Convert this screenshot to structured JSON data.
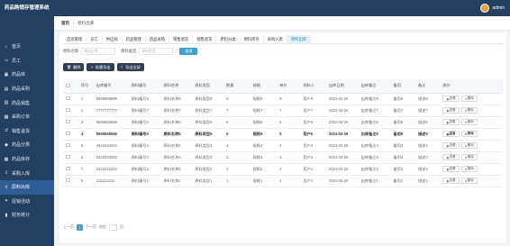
{
  "app": {
    "title": "药品购销存管理系统"
  },
  "user": {
    "name": "admin"
  },
  "sidebar": {
    "items": [
      {
        "label": "首页",
        "icon": "home-icon",
        "active": false
      },
      {
        "label": "员工",
        "icon": "user-icon",
        "active": false
      },
      {
        "label": "药品库",
        "icon": "box-icon",
        "active": false
      },
      {
        "label": "药品采购",
        "icon": "cart-icon",
        "active": false
      },
      {
        "label": "药品销售",
        "icon": "sale-icon",
        "active": false
      },
      {
        "label": "采购订单",
        "icon": "order-icon",
        "active": false
      },
      {
        "label": "销售退货",
        "icon": "return-icon",
        "active": false
      },
      {
        "label": "药品分类",
        "icon": "tag-icon",
        "active": false
      },
      {
        "label": "药品库存",
        "icon": "stock-icon",
        "active": false
      },
      {
        "label": "采购入库",
        "icon": "inbound-icon",
        "active": false
      },
      {
        "label": "原料出库",
        "icon": "outbound-icon",
        "active": true
      },
      {
        "label": "促销活动",
        "icon": "gift-icon",
        "active": false
      },
      {
        "label": "财务统计",
        "icon": "chart-icon",
        "active": false
      }
    ]
  },
  "breadcrumb": {
    "home": "首页",
    "current": "原料出库"
  },
  "menubar": {
    "items": [
      {
        "label": "首页管理",
        "active": false
      },
      {
        "label": "员工",
        "active": false
      },
      {
        "label": "供应商",
        "active": false
      },
      {
        "label": "药品管理",
        "active": false
      },
      {
        "label": "药品采购",
        "active": false
      },
      {
        "label": "销售退货",
        "active": false
      },
      {
        "label": "销售退货",
        "active": false
      },
      {
        "label": "原料分类",
        "active": false
      },
      {
        "label": "原料库存",
        "active": false
      },
      {
        "label": "采购入库",
        "active": false
      },
      {
        "label": "原料出库",
        "active": true
      }
    ]
  },
  "search": {
    "name_label": "原料名称",
    "name_placeholder": "原料名称",
    "type_label": "原料类型",
    "type_placeholder": "原料类型",
    "button": "查询"
  },
  "actions": {
    "delete": "删除",
    "export_selected": "批量导出",
    "export_all": "导出全部"
  },
  "table": {
    "headers": [
      "",
      "序号",
      "出库编号",
      "原料编号",
      "原料名称",
      "原料类型",
      "数量",
      "规格",
      "单价",
      "领料人",
      "出库日期",
      "出库备注",
      "备用",
      "备注",
      "操作"
    ],
    "rows": [
      {
        "no": "1",
        "out_no": "9999999999",
        "code": "原料编号9",
        "name": "原料名称9",
        "type": "原料类型9",
        "qty": "9",
        "spec": "规格9",
        "price": "9",
        "taker": "用户9",
        "date": "2024-03-26",
        "remark": "出库备注9",
        "extra": "备用9",
        "note": "描述9",
        "highlight": false
      },
      {
        "no": "2",
        "out_no": "7777777777",
        "code": "原料编号7",
        "name": "原料名称7",
        "type": "原料类型7",
        "qty": "7",
        "spec": "规格7",
        "price": "7",
        "taker": "用户7",
        "date": "2024-03-26",
        "remark": "出库备注7",
        "extra": "备用7",
        "note": "描述7",
        "highlight": false
      },
      {
        "no": "3",
        "out_no": "6666666666",
        "code": "原料编号6",
        "name": "原料名称6",
        "type": "原料类型6",
        "qty": "6",
        "spec": "规格6",
        "price": "6",
        "taker": "用户6",
        "date": "2024-03-26",
        "remark": "出库备注6",
        "extra": "备用6",
        "note": "描述6",
        "highlight": false
      },
      {
        "no": "4",
        "out_no": "5555555555",
        "code": "原料编号5",
        "name": "原料名称5",
        "type": "原料类型5",
        "qty": "5",
        "spec": "规格5",
        "price": "5",
        "taker": "用户5",
        "date": "2024-03-26",
        "remark": "出库备注5",
        "extra": "备用5",
        "note": "描述5",
        "highlight": true
      },
      {
        "no": "5",
        "out_no": "4444444444",
        "code": "原料编号4",
        "name": "原料名称4",
        "type": "原料类型4",
        "qty": "4",
        "spec": "规格4",
        "price": "4",
        "taker": "用户4",
        "date": "2024-03-26",
        "remark": "出库备注4",
        "extra": "备用4",
        "note": "描述4",
        "highlight": false
      },
      {
        "no": "6",
        "out_no": "3333333333",
        "code": "原料编号3",
        "name": "原料名称3",
        "type": "原料类型3",
        "qty": "3",
        "spec": "规格3",
        "price": "3",
        "taker": "用户3",
        "date": "2024-03-26",
        "remark": "出库备注3",
        "extra": "备用3",
        "note": "描述3",
        "highlight": false
      },
      {
        "no": "7",
        "out_no": "2222222222",
        "code": "原料编号2",
        "name": "原料名称2",
        "type": "原料类型2",
        "qty": "2",
        "spec": "规格2",
        "price": "2",
        "taker": "用户2",
        "date": "2024-03-26",
        "remark": "出库备注2",
        "extra": "备用2",
        "note": "描述2",
        "highlight": false
      },
      {
        "no": "8",
        "out_no": "1111111111",
        "code": "原料编号1",
        "name": "原料名称1",
        "type": "原料类型1",
        "qty": "1",
        "spec": "规格1",
        "price": "1",
        "taker": "用户1",
        "date": "2024-03-26",
        "remark": "出库备注1",
        "extra": "备用1",
        "note": "描述1",
        "highlight": false
      }
    ],
    "view_label": "查看",
    "delete_label": "删除"
  },
  "pagination": {
    "prev": "上一页",
    "current": "1",
    "next": "下一页",
    "goto_label": "前往",
    "page_unit": "页"
  },
  "colors": {
    "sidebar_bg": "#234060",
    "active_bg": "#2f5d96",
    "accent": "#3ea0d6",
    "action_btn": "#2f3e55"
  }
}
